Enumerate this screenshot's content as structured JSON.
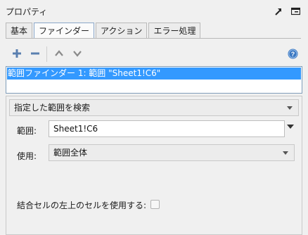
{
  "header": {
    "title": "プロパティ",
    "icons": [
      "pin-arrow-icon",
      "panel-menu-icon"
    ]
  },
  "tabs": [
    {
      "label": "基本",
      "active": false
    },
    {
      "label": "ファインダー",
      "active": true
    },
    {
      "label": "アクション",
      "active": false
    },
    {
      "label": "エラー処理",
      "active": false
    }
  ],
  "toolbar": {
    "icons": [
      "add-icon",
      "remove-icon",
      "move-up-icon",
      "move-down-icon",
      "help-icon"
    ]
  },
  "finder_list": {
    "items": [
      {
        "label": "範囲ファインダー 1: 範囲 \"Sheet1!C6\"",
        "selected": true
      }
    ]
  },
  "properties": {
    "mode_select": "指定した範囲を検索",
    "range_label": "範囲:",
    "range_value": "Sheet1!C6",
    "use_label": "使用:",
    "use_value": "範囲全体",
    "merged_label": "結合セルの左上のセルを使用する:",
    "merged_checked": false
  },
  "colors": {
    "selection": "#3399ff",
    "help_icon": "#3b78c2"
  }
}
